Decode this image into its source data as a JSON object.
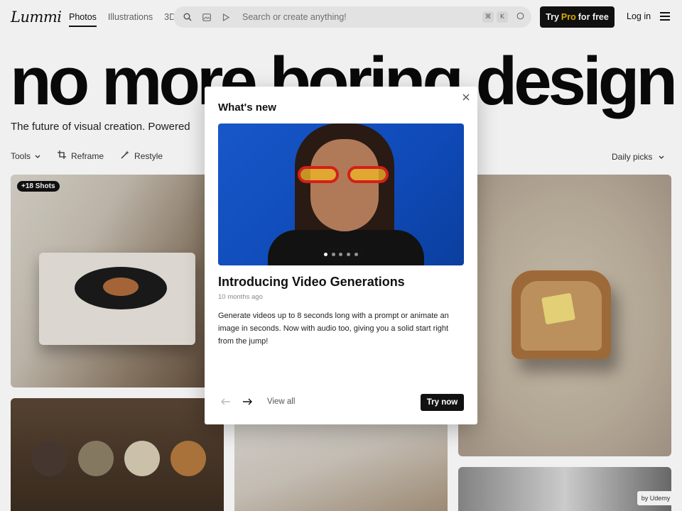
{
  "nav": {
    "logo": "Lummi",
    "tabs": [
      {
        "label": "Photos",
        "active": true
      },
      {
        "label": "Illustrations",
        "active": false
      },
      {
        "label": "3D",
        "active": false
      }
    ],
    "search_placeholder": "Search or create anything!",
    "shortcut_keys": [
      "⌘",
      "K"
    ],
    "try_pro": {
      "prefix": "Try",
      "pro": "Pro",
      "suffix": "for free"
    },
    "login": "Log in"
  },
  "hero": {
    "headline": "no more boring design",
    "subtitle": "The future of visual creation. Powered"
  },
  "toolbar": {
    "tools_label": "Tools",
    "reframe_label": "Reframe",
    "restyle_label": "Restyle",
    "sort_label": "Daily picks"
  },
  "grid": {
    "badge": "+18 Shots"
  },
  "modal": {
    "title": "What's new",
    "article_title": "Introducing Video Generations",
    "article_time": "10 months ago",
    "article_body": "Generate videos up to 8 seconds long with a prompt or animate an image in seconds. Now with audio too, giving you a solid start right from the jump!",
    "carousel_dots": 5,
    "active_dot": 0,
    "view_all": "View all",
    "try_now": "Try now"
  },
  "footer_badge": "by Udemy",
  "colors": {
    "accent": "#111111",
    "pro": "#e6b800",
    "media_bg": "#1757c8"
  }
}
